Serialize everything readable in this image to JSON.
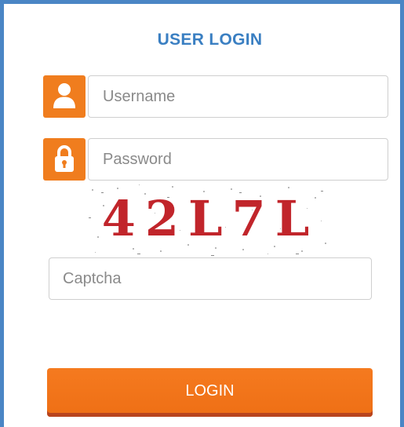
{
  "login_form": {
    "title": "USER LOGIN",
    "username": {
      "placeholder": "Username",
      "value": "",
      "icon": "user-icon"
    },
    "password": {
      "placeholder": "Password",
      "value": "",
      "icon": "padlock-icon"
    },
    "captcha_image": {
      "text": "42L7L"
    },
    "captcha_input": {
      "placeholder": "Captcha",
      "value": ""
    },
    "login_button": "LOGIN"
  },
  "colors": {
    "title": "#3a7fc2",
    "frame_border": "#4a86c5",
    "accent": "#f07d1e",
    "captcha_text": "#c1252b"
  }
}
